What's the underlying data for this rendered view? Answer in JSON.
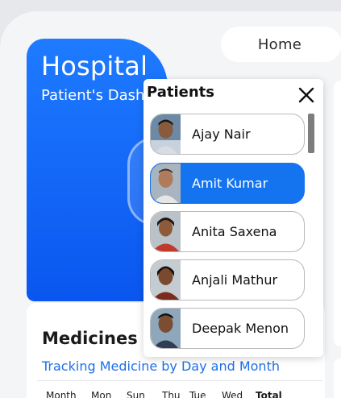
{
  "header": {
    "home_label": "Home"
  },
  "hero": {
    "title": "Hospital",
    "subtitle": "Patient's Dashboard"
  },
  "medicines": {
    "title": "Medicines",
    "subtitle": "Tracking Medicine by Day and Month",
    "columns": [
      "Month",
      "Mon",
      "Sun",
      "Thu",
      "Tue",
      "Wed",
      "Total"
    ]
  },
  "patients_panel": {
    "title": "Patients",
    "close_icon": "close-icon",
    "patients": [
      {
        "name": "Ajay Nair",
        "selected": false
      },
      {
        "name": "Amit Kumar",
        "selected": true
      },
      {
        "name": "Anita Saxena",
        "selected": false
      },
      {
        "name": "Anjali Mathur",
        "selected": false
      },
      {
        "name": "Deepak Menon",
        "selected": false
      }
    ]
  },
  "colors": {
    "accent": "#1474f0",
    "hero_gradient_top": "#1e7bff",
    "hero_gradient_bottom": "#0a56f0",
    "link": "#1d6fe8"
  }
}
